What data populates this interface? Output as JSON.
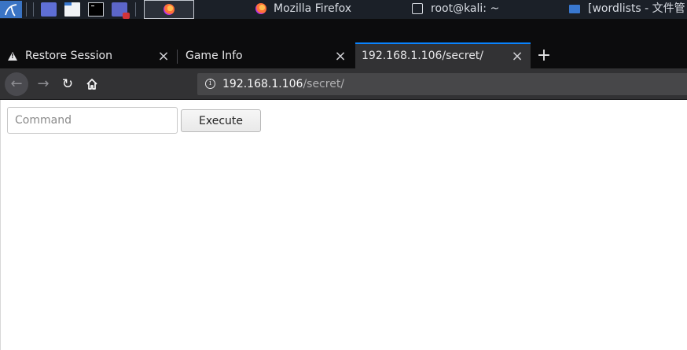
{
  "taskbar": {
    "windows": [
      {
        "title": "Mozilla Firefox",
        "icon": "firefox-icon"
      },
      {
        "title": "root@kali: ~",
        "icon": "terminal-icon"
      },
      {
        "title": "[wordlists - 文件管",
        "icon": "folder-icon"
      }
    ]
  },
  "browser": {
    "tabs": [
      {
        "label": "Restore Session",
        "icon": "warning-icon",
        "active": false
      },
      {
        "label": "Game Info",
        "active": false
      },
      {
        "label": "192.168.1.106/secret/",
        "active": true
      }
    ],
    "close_glyph": "×",
    "new_tab_glyph": "+",
    "nav": {
      "back": "←",
      "forward": "→",
      "reload": "↻"
    },
    "url": {
      "host": "192.168.1.106",
      "path": "/secret/"
    }
  },
  "page": {
    "command_placeholder": "Command",
    "command_value": "",
    "execute_label": "Execute"
  },
  "colors": {
    "tab_accent": "#0a84ff",
    "toolbar": "#323234",
    "taskbar": "#1b2028"
  }
}
